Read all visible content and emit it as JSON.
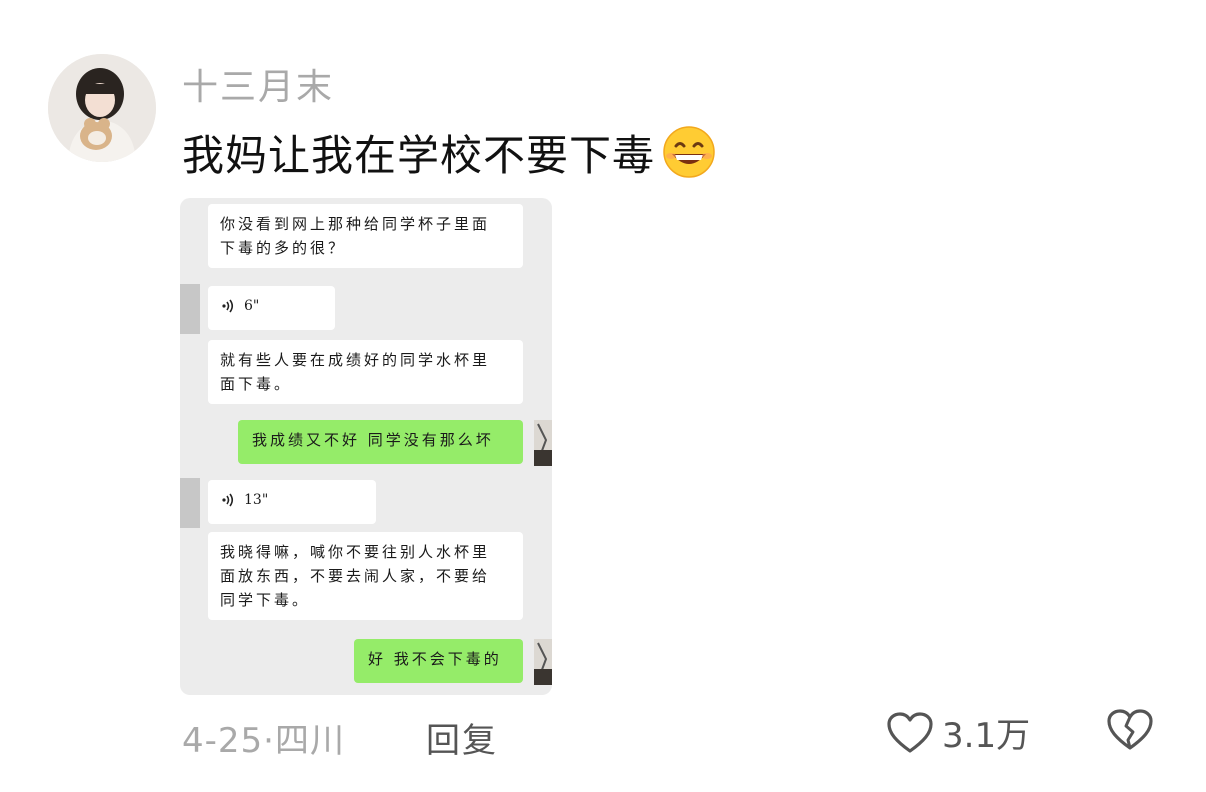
{
  "comment": {
    "username": "十三月末",
    "text": "我妈让我在学校不要下毒",
    "emoji": "grinning-face-emoji",
    "date": "4-25",
    "location": "四川",
    "meta_separator": "·",
    "reply_label": "回复",
    "like_count": "3.1万"
  },
  "chat": {
    "messages": [
      {
        "side": "left",
        "lines": [
          "你没看到网上那种给同学杯子里面",
          "下毒的多的很？"
        ]
      },
      {
        "side": "left",
        "type": "voice",
        "duration": "6\""
      },
      {
        "side": "left",
        "lines": [
          "就有些人要在成绩好的同学水杯里",
          "面下毒。"
        ]
      },
      {
        "side": "right",
        "lines": [
          "我成绩又不好 同学没有那么坏"
        ]
      },
      {
        "side": "left",
        "type": "voice",
        "duration": "13\""
      },
      {
        "side": "left",
        "lines": [
          "我晓得嘛，喊你不要往别人水杯里",
          "面放东西，不要去闹人家，不要给",
          "同学下毒。"
        ]
      },
      {
        "side": "right",
        "lines": [
          "好 我不会下毒的"
        ]
      }
    ]
  },
  "colors": {
    "green_bubble": "#95ec69",
    "chat_background": "#ececec",
    "meta_gray": "#a9a9a9"
  }
}
